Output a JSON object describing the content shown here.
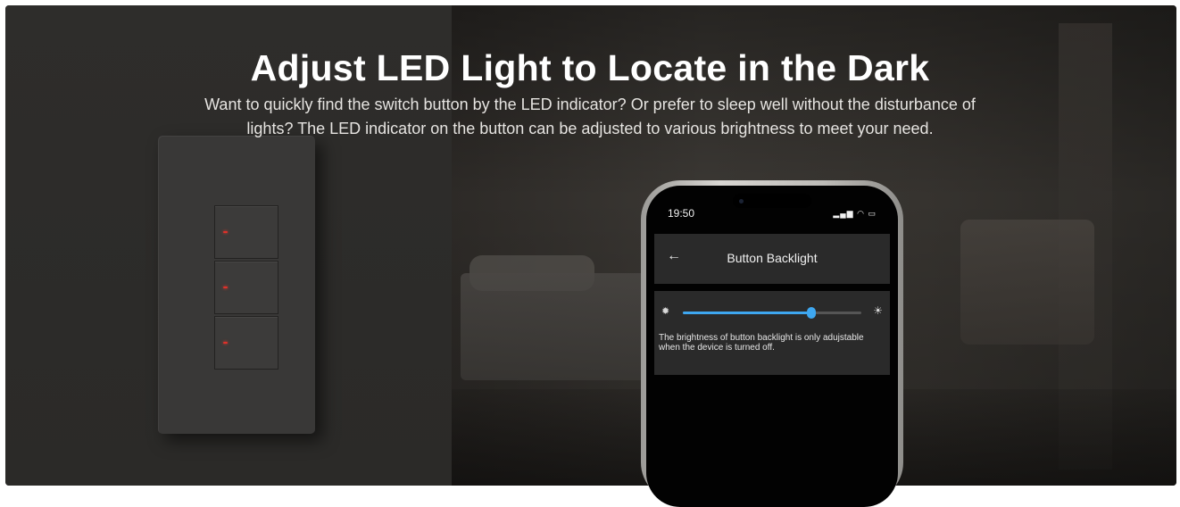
{
  "hero": {
    "title": "Adjust LED Light to Locate in the Dark",
    "subtitle_line1": "Want to quickly find the switch button by the LED indicator? Or prefer to sleep well without the disturbance of",
    "subtitle_line2": "lights? The LED indicator on the button can be adjusted to various brightness to meet your need."
  },
  "phone": {
    "status_time": "19:50",
    "appbar_title": "Button Backlight",
    "back_icon": "arrow-left-icon",
    "brightness": {
      "min_icon": "sun-low-icon",
      "max_icon": "sun-high-icon",
      "level_percent": 72,
      "accent_color": "#3ea7f0"
    },
    "note_line1": "The brightness of button backlight is only adujstable",
    "note_line2": "when the device is turned off."
  },
  "switch_panel": {
    "led_color": "#e0302a"
  }
}
